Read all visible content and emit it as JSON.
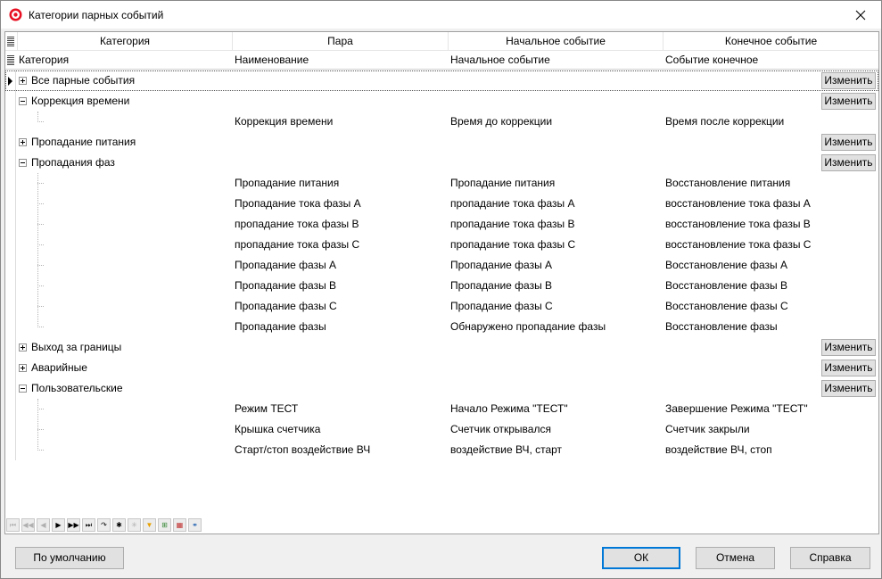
{
  "window": {
    "title": "Категории парных событий"
  },
  "grid": {
    "header_top": [
      "Категория",
      "Пара",
      "Начальное событие",
      "Конечное событие"
    ],
    "header_sub": [
      "Категория",
      "Наименование",
      "Начальное событие",
      "Событие конечное"
    ],
    "edit_label": "Изменить",
    "groups": [
      {
        "label": "Все парные события",
        "expanded": false,
        "editable": true,
        "current": true,
        "items": []
      },
      {
        "label": "Коррекция времени",
        "expanded": true,
        "editable": true,
        "items": [
          {
            "name": "Коррекция времени",
            "start": "Время до коррекции",
            "end": "Время после коррекции"
          }
        ]
      },
      {
        "label": "Пропадание питания",
        "expanded": false,
        "editable": true,
        "items": []
      },
      {
        "label": "Пропадания фаз",
        "expanded": true,
        "editable": true,
        "items": [
          {
            "name": "Пропадание питания",
            "start": "Пропадание питания",
            "end": "Восстановление питания"
          },
          {
            "name": "Пропадание тока фазы A",
            "start": "пропадание тока фазы A",
            "end": "восстановление тока фазы A"
          },
          {
            "name": "пропадание тока фазы B",
            "start": "пропадание тока фазы B",
            "end": "восстановление тока фазы B"
          },
          {
            "name": "пропадание тока фазы C",
            "start": "пропадание тока фазы C",
            "end": "восстановление тока фазы C"
          },
          {
            "name": "Пропадание фазы A",
            "start": "Пропадание фазы A",
            "end": "Восстановление фазы A"
          },
          {
            "name": "Пропадание фазы B",
            "start": "Пропадание фазы B",
            "end": "Восстановление фазы B"
          },
          {
            "name": "Пропадание фазы C",
            "start": "Пропадание фазы C",
            "end": "Восстановление фазы C"
          },
          {
            "name": "Пропадание фазы",
            "start": "Обнаружено пропадание фазы",
            "end": "Восстановление фазы"
          }
        ]
      },
      {
        "label": "Выход за границы",
        "expanded": false,
        "editable": true,
        "items": []
      },
      {
        "label": "Аварийные",
        "expanded": false,
        "editable": true,
        "items": []
      },
      {
        "label": "Пользовательские",
        "expanded": true,
        "editable": true,
        "items": [
          {
            "name": "Режим ТЕСТ",
            "start": "Начало Режима \"ТЕСТ\"",
            "end": "Завершение Режима \"ТЕСТ\""
          },
          {
            "name": "Крышка счетчика",
            "start": "Счетчик открывался",
            "end": "Счетчик закрыли"
          },
          {
            "name": "Старт/стоп воздействие ВЧ",
            "start": "воздействие ВЧ, старт",
            "end": "воздействие ВЧ, стоп"
          }
        ]
      }
    ]
  },
  "navigator": [
    {
      "icon": "first-page-icon",
      "glyph": "⏮",
      "enabled": false
    },
    {
      "icon": "prior-page-icon",
      "glyph": "◀◀",
      "enabled": false
    },
    {
      "icon": "prior-record-icon",
      "glyph": "◀",
      "enabled": false
    },
    {
      "icon": "next-record-icon",
      "glyph": "▶",
      "enabled": true
    },
    {
      "icon": "next-page-icon",
      "glyph": "▶▶",
      "enabled": true
    },
    {
      "icon": "last-page-icon",
      "glyph": "⏭",
      "enabled": true
    },
    {
      "icon": "refresh-icon",
      "glyph": "↷",
      "enabled": true
    },
    {
      "icon": "insert-icon",
      "glyph": "✱",
      "enabled": true
    },
    {
      "icon": "delete-icon",
      "glyph": "✳",
      "enabled": false
    },
    {
      "icon": "filter-icon",
      "glyph": "▼",
      "enabled": true
    },
    {
      "icon": "export-icon",
      "glyph": "⊞",
      "enabled": true
    },
    {
      "icon": "columns-icon",
      "glyph": "▦",
      "enabled": true
    },
    {
      "icon": "find-icon",
      "glyph": "⚭",
      "enabled": true
    }
  ],
  "buttons": {
    "default": "По умолчанию",
    "ok": "ОК",
    "cancel": "Отмена",
    "help": "Справка"
  },
  "colors": {
    "accent": "#0078d7",
    "app_icon": "#e81123"
  }
}
